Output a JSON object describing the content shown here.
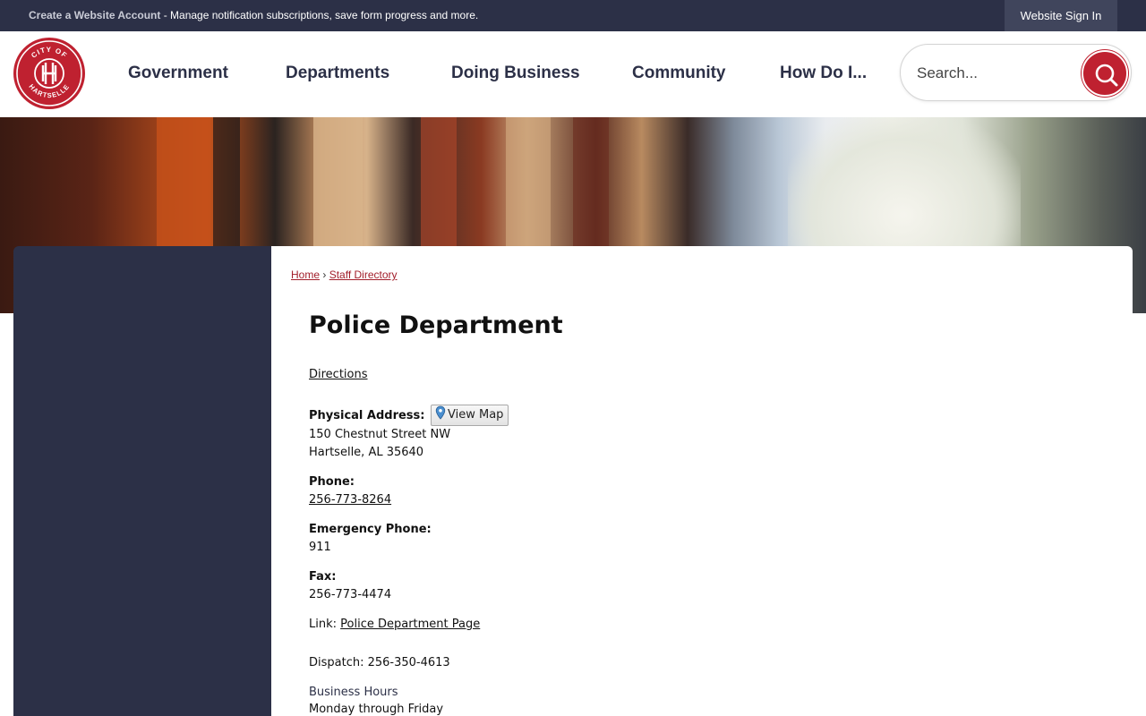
{
  "topbar": {
    "create_account": "Create a Website Account",
    "message": " - Manage notification subscriptions, save form progress and more.",
    "sign_in": "Website Sign In"
  },
  "logo": {
    "top_text": "CITY OF",
    "bottom_text": "HARTSELLE",
    "brand_color": "#bf2130"
  },
  "nav": {
    "items": [
      "Government",
      "Departments",
      "Doing Business",
      "Community",
      "How Do I..."
    ]
  },
  "search": {
    "placeholder": "Search...",
    "icon": "search-icon"
  },
  "breadcrumb": {
    "home": "Home",
    "separator": "›",
    "current": "Staff Directory"
  },
  "page": {
    "title": "Police Department",
    "directions": "Directions",
    "physical_address_label": "Physical Address:",
    "view_map": "View Map",
    "address_line1": "150 Chestnut Street NW",
    "address_line2": "Hartselle, AL 35640",
    "phone_label": "Phone:",
    "phone": "256-773-8264",
    "emergency_label": "Emergency Phone:",
    "emergency": "911",
    "fax_label": "Fax:",
    "fax": "256-773-4474",
    "link_label": "Link: ",
    "link_text": "Police Department Page",
    "dispatch": "Dispatch: 256-350-4613",
    "hours_title": "Business Hours",
    "hours_line1": "Monday through Friday"
  },
  "colors": {
    "navy": "#2c3047",
    "accent_red": "#a21e2a"
  }
}
